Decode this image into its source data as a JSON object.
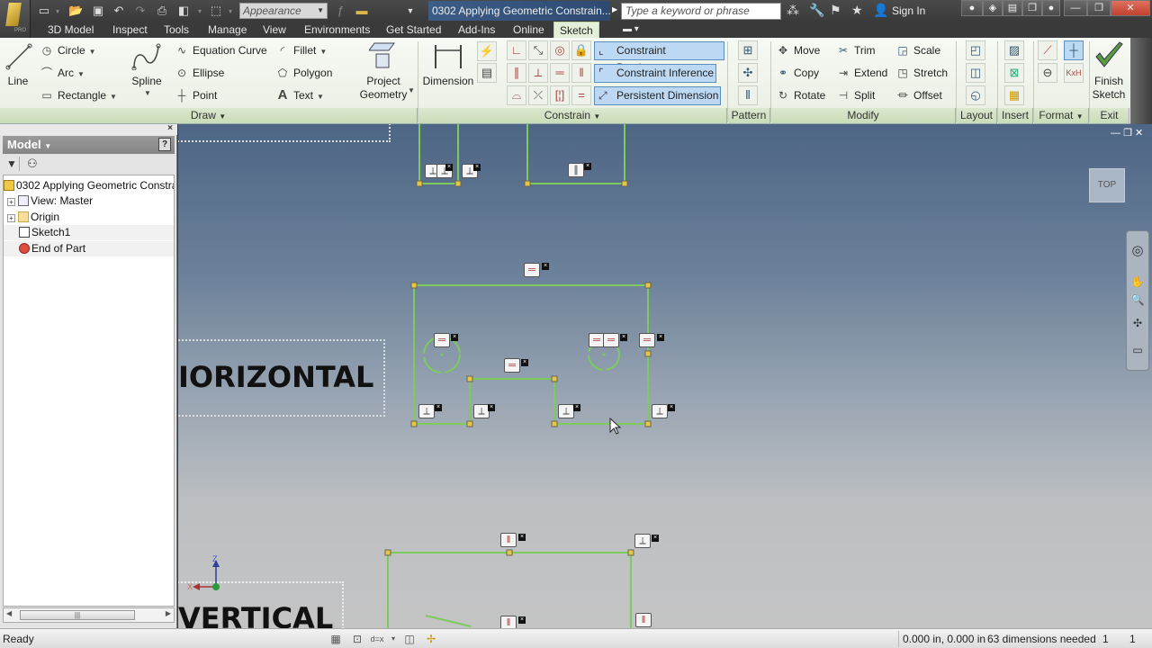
{
  "app": {
    "document_title": "0302 Applying Geometric Constrain...",
    "appearance_select": "Appearance",
    "search_placeholder": "Type a keyword or phrase",
    "sign_in": "Sign In",
    "app_edition": "PRO"
  },
  "quick_access": [
    "new-icon",
    "open-icon",
    "save-icon",
    "undo-icon",
    "redo-icon",
    "print-icon",
    "material-icon",
    "select-icon",
    "formula-icon",
    "measure-icon"
  ],
  "menu_tabs": [
    {
      "label": "3D Model",
      "active": false
    },
    {
      "label": "Inspect",
      "active": false
    },
    {
      "label": "Tools",
      "active": false
    },
    {
      "label": "Manage",
      "active": false
    },
    {
      "label": "View",
      "active": false
    },
    {
      "label": "Environments",
      "active": false
    },
    {
      "label": "Get Started",
      "active": false
    },
    {
      "label": "Add-Ins",
      "active": false
    },
    {
      "label": "Online",
      "active": false
    },
    {
      "label": "Sketch",
      "active": true
    }
  ],
  "ribbon": {
    "draw": {
      "label": "Draw",
      "line": "Line",
      "circle": "Circle",
      "arc": "Arc",
      "rectangle": "Rectangle",
      "spline": "Spline",
      "equation_curve": "Equation Curve",
      "ellipse": "Ellipse",
      "point": "Point",
      "fillet": "Fillet",
      "polygon": "Polygon",
      "text": "Text",
      "project_geometry_1": "Project",
      "project_geometry_2": "Geometry"
    },
    "constrain": {
      "label": "Constrain",
      "dimension": "Dimension",
      "constraint_persistence": "Constraint Persistence",
      "constraint_inference": "Constraint Inference",
      "persistent_dimension": "Persistent Dimension"
    },
    "pattern": {
      "label": "Pattern"
    },
    "modify": {
      "label": "Modify",
      "move": "Move",
      "copy": "Copy",
      "rotate": "Rotate",
      "trim": "Trim",
      "extend": "Extend",
      "split": "Split",
      "scale": "Scale",
      "stretch": "Stretch",
      "offset": "Offset"
    },
    "layout": {
      "label": "Layout"
    },
    "insert": {
      "label": "Insert"
    },
    "format": {
      "label": "Format"
    },
    "exit": {
      "label": "Exit",
      "finish_1": "Finish",
      "finish_2": "Sketch"
    }
  },
  "browser": {
    "title": "Model",
    "help": "?",
    "tree": [
      {
        "label": "0302 Applying Geometric Constra",
        "icon": "part-icon",
        "level": 0
      },
      {
        "label": "View: Master",
        "icon": "view-icon",
        "level": 1,
        "expandable": true
      },
      {
        "label": "Origin",
        "icon": "folder-icon",
        "level": 1,
        "expandable": true
      },
      {
        "label": "Sketch1",
        "icon": "sketch-icon",
        "level": 1,
        "selected": true
      },
      {
        "label": "End of Part",
        "icon": "end-of-part-icon",
        "level": 1,
        "selected": true
      }
    ]
  },
  "viewport": {
    "label_horizontal": "IORIZONTAL",
    "label_vertical": "VERTICAL",
    "viewcube": "TOP",
    "axis_x": "X",
    "axis_z": "Z"
  },
  "status": {
    "ready": "Ready",
    "coordinates": "0.000 in, 0.000 in",
    "dimensions_needed": "63 dimensions needed",
    "count_1": "1",
    "count_2": "1"
  },
  "colors": {
    "sketch_line": "#7ccb5c",
    "endpoint": "#e8c447",
    "active_toggle": "#bcd8f3",
    "ribbon_panel": "#d3e3c4"
  }
}
